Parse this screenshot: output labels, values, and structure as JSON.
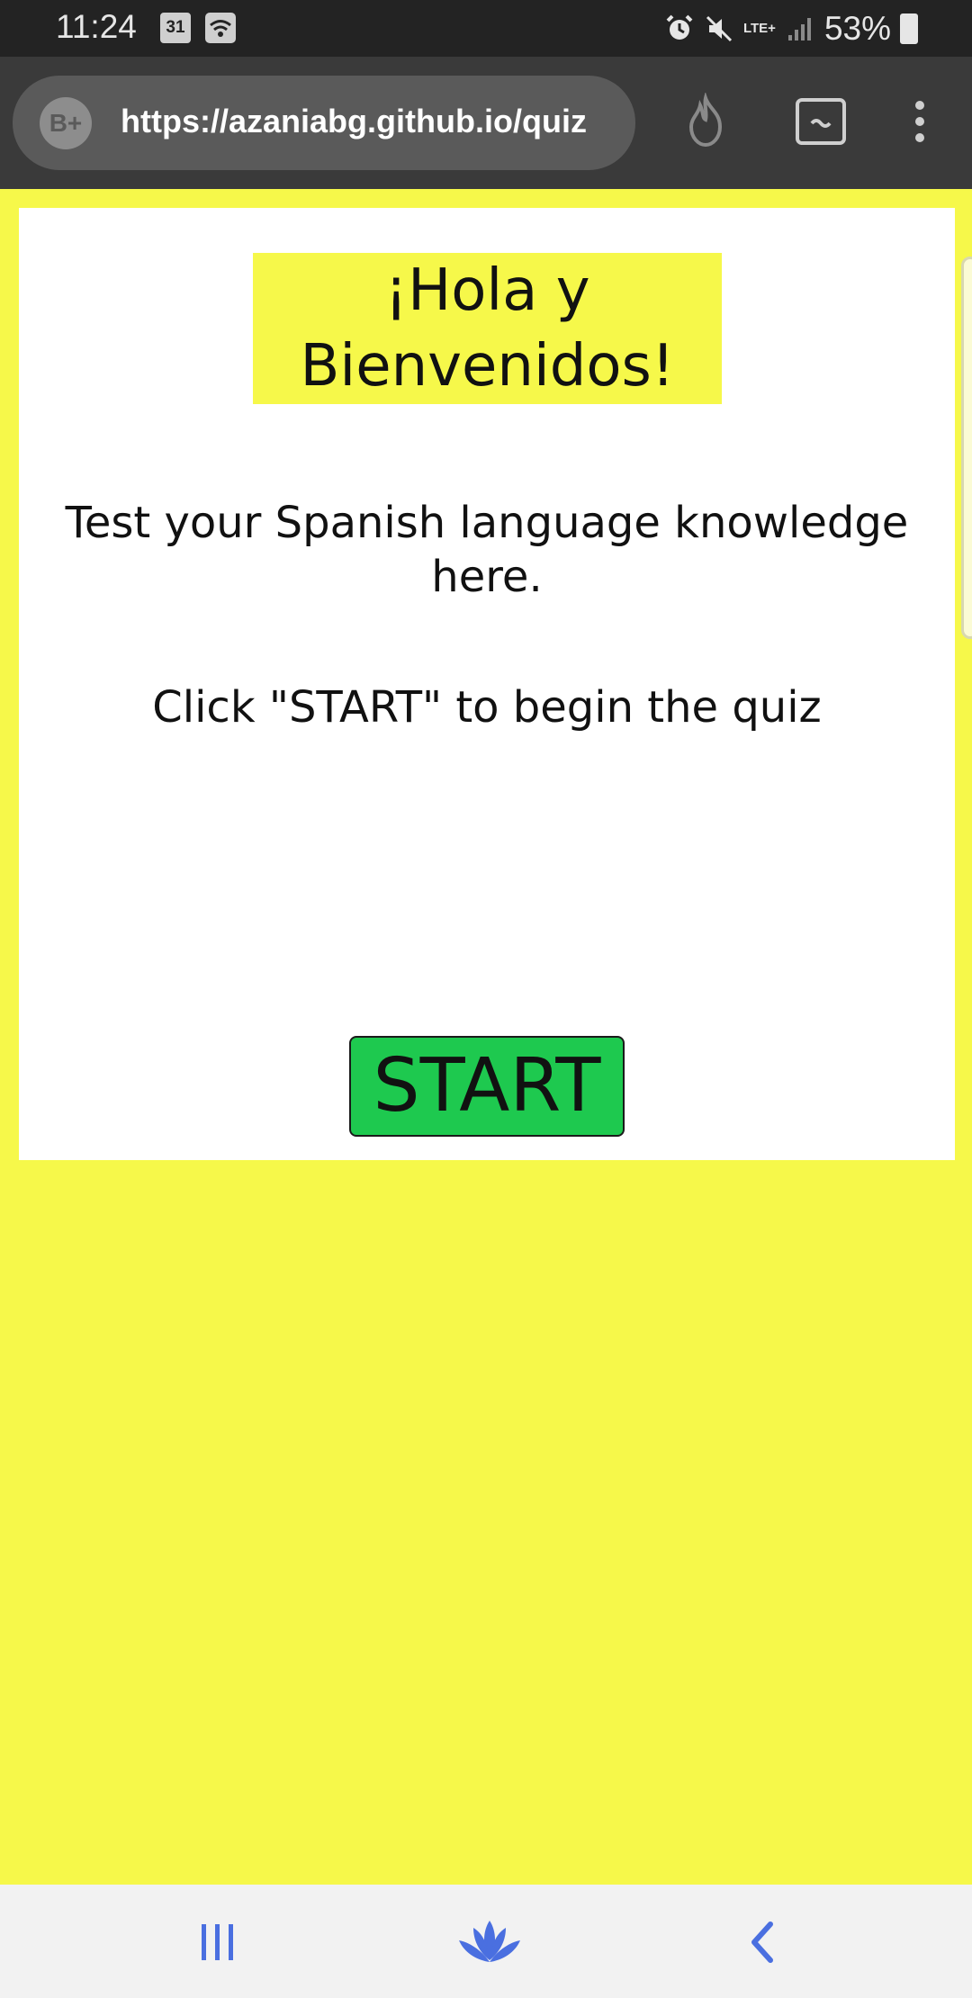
{
  "status_bar": {
    "time": "11:24",
    "calendar_day": "31",
    "network": "LTE+",
    "battery": "53%"
  },
  "browser": {
    "badge": "B+",
    "url": "https://azaniabg.github.io/quiz"
  },
  "page": {
    "title_line1": "¡Hola y",
    "title_line2": "Bienvenidos!",
    "subtitle": "Test your Spanish language knowledge here.",
    "instruction": "Click \"START\" to begin the quiz",
    "start_label": "START"
  },
  "colors": {
    "page_background": "#f6f84a",
    "card_background": "#ffffff",
    "start_button": "#1ec94f",
    "nav_accent": "#4a6fe0"
  },
  "icons": [
    "calendar-icon",
    "wifi-icon",
    "alarm-icon",
    "mute-icon",
    "signal-icon",
    "battery-icon",
    "flame-icon",
    "tab-switcher-icon",
    "more-menu-icon",
    "recent-apps-icon",
    "home-lotus-icon",
    "back-icon"
  ]
}
